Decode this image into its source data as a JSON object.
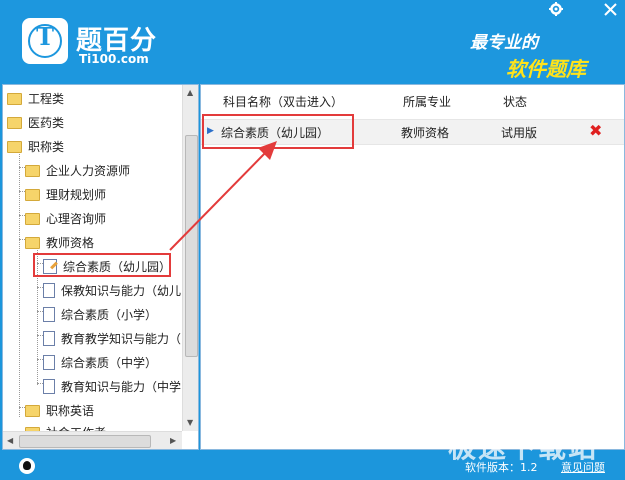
{
  "header": {
    "brand": "题百分",
    "url": "Ti100.com",
    "slogan_line1": "最专业的",
    "slogan_line2": "软件题库",
    "settings_icon": "gear-icon",
    "close_icon": "close-icon"
  },
  "tree": {
    "items": [
      {
        "label": "工程类",
        "icon": "folder-icon"
      },
      {
        "label": "医药类",
        "icon": "folder-icon"
      },
      {
        "label": "职称类",
        "icon": "folder-icon"
      },
      {
        "label": "企业人力资源师",
        "icon": "folder-icon"
      },
      {
        "label": "理财规划师",
        "icon": "folder-icon"
      },
      {
        "label": "心理咨询师",
        "icon": "folder-icon"
      },
      {
        "label": "教师资格",
        "icon": "folder-icon"
      },
      {
        "label": "综合素质（幼儿园）",
        "icon": "document-edit-icon"
      },
      {
        "label": "保教知识与能力（幼儿",
        "icon": "document-icon"
      },
      {
        "label": "综合素质（小学）",
        "icon": "document-icon"
      },
      {
        "label": "教育教学知识与能力（",
        "icon": "document-icon"
      },
      {
        "label": "综合素质（中学）",
        "icon": "document-icon"
      },
      {
        "label": "教育知识与能力（中学",
        "icon": "document-icon"
      },
      {
        "label": "职称英语",
        "icon": "folder-icon"
      },
      {
        "label": "社会工作者",
        "icon": "folder-icon"
      }
    ]
  },
  "table": {
    "columns": [
      "科目名称（双击进入）",
      "所属专业",
      "状态"
    ],
    "rows": [
      {
        "name": "综合素质（幼儿园）",
        "major": "教师资格",
        "status": "试用版",
        "delete_icon": "delete-x-icon"
      }
    ]
  },
  "footer": {
    "version": "软件版本：1.2",
    "feedback": "意见问题"
  },
  "watermark": "极速下载站",
  "colors": {
    "brand_blue": "#1d97de",
    "highlight_red": "#e33b3b",
    "slogan_yellow": "#ffe31a"
  }
}
